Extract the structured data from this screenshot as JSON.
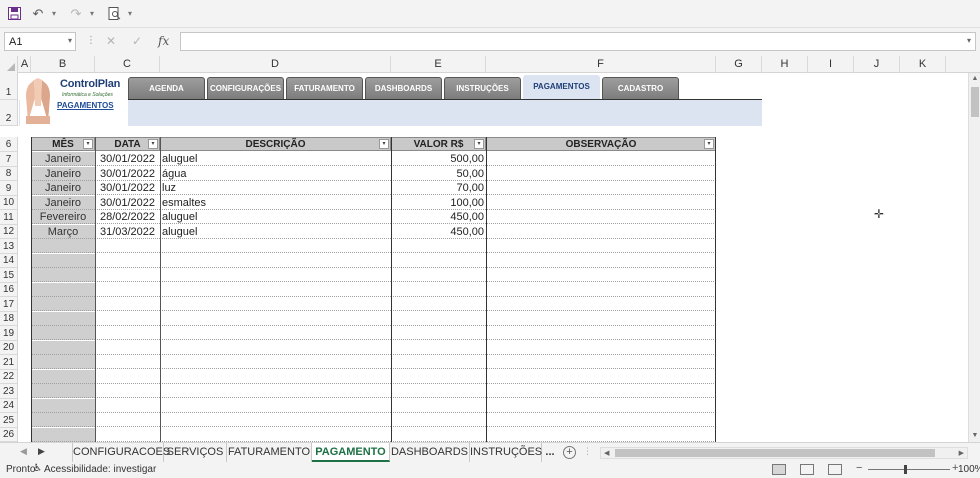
{
  "quick_access": {
    "save_icon": "save-icon",
    "undo_icon": "undo-icon",
    "redo_icon": "redo-icon",
    "print_preview_icon": "print-preview-icon",
    "customize_icon": "customize-icon"
  },
  "formula_bar": {
    "name_box": "A1",
    "cancel_icon": "✕",
    "enter_icon": "✓",
    "fx_label": "fx",
    "formula": ""
  },
  "columns": [
    "A",
    "B",
    "C",
    "D",
    "E",
    "F",
    "G",
    "H",
    "I",
    "J",
    "K"
  ],
  "rows": [
    "1",
    "2",
    "6",
    "7",
    "8",
    "9",
    "10",
    "11",
    "12",
    "13",
    "14",
    "15",
    "16",
    "17",
    "18",
    "19",
    "20",
    "21",
    "22",
    "23",
    "24",
    "25",
    "26"
  ],
  "header": {
    "brand": "ControlPlan",
    "tagline": "Informática e Soluções",
    "breadcrumb": "PAGAMENTOS",
    "tabs": [
      "AGENDA",
      "CONFIGURAÇÕES",
      "FATURAMENTO",
      "DASHBOARDS",
      "INSTRUÇÕES",
      "PAGAMENTOS",
      "CADASTRO"
    ],
    "active_tab": "PAGAMENTOS"
  },
  "table": {
    "headers": {
      "mes": "MÊS",
      "data": "DATA",
      "descricao": "DESCRIÇÃO",
      "valor": "VALOR R$",
      "observacao": "OBSERVAÇÃO"
    },
    "filter_icon": "▾",
    "rows": [
      {
        "mes": "Janeiro",
        "data": "30/01/2022",
        "descricao": "aluguel",
        "valor": "500,00",
        "observacao": ""
      },
      {
        "mes": "Janeiro",
        "data": "30/01/2022",
        "descricao": "água",
        "valor": "50,00",
        "observacao": ""
      },
      {
        "mes": "Janeiro",
        "data": "30/01/2022",
        "descricao": "luz",
        "valor": "70,00",
        "observacao": ""
      },
      {
        "mes": "Janeiro",
        "data": "30/01/2022",
        "descricao": "esmaltes",
        "valor": "100,00",
        "observacao": ""
      },
      {
        "mes": "Fevereiro",
        "data": "28/02/2022",
        "descricao": "aluguel",
        "valor": "450,00",
        "observacao": ""
      },
      {
        "mes": "Março",
        "data": "31/03/2022",
        "descricao": "aluguel",
        "valor": "450,00",
        "observacao": ""
      }
    ]
  },
  "sheet_tabs": {
    "items": [
      "CONFIGURACOES",
      "SERVIÇOS",
      "FATURAMENTO",
      "PAGAMENTO",
      "DASHBOARDS",
      "INSTRUÇÕES"
    ],
    "active": "PAGAMENTO",
    "more": "...",
    "add_label": "+"
  },
  "status": {
    "ready": "Pronto",
    "accessibility": "Acessibilidade: investigar",
    "zoom": "100%"
  }
}
